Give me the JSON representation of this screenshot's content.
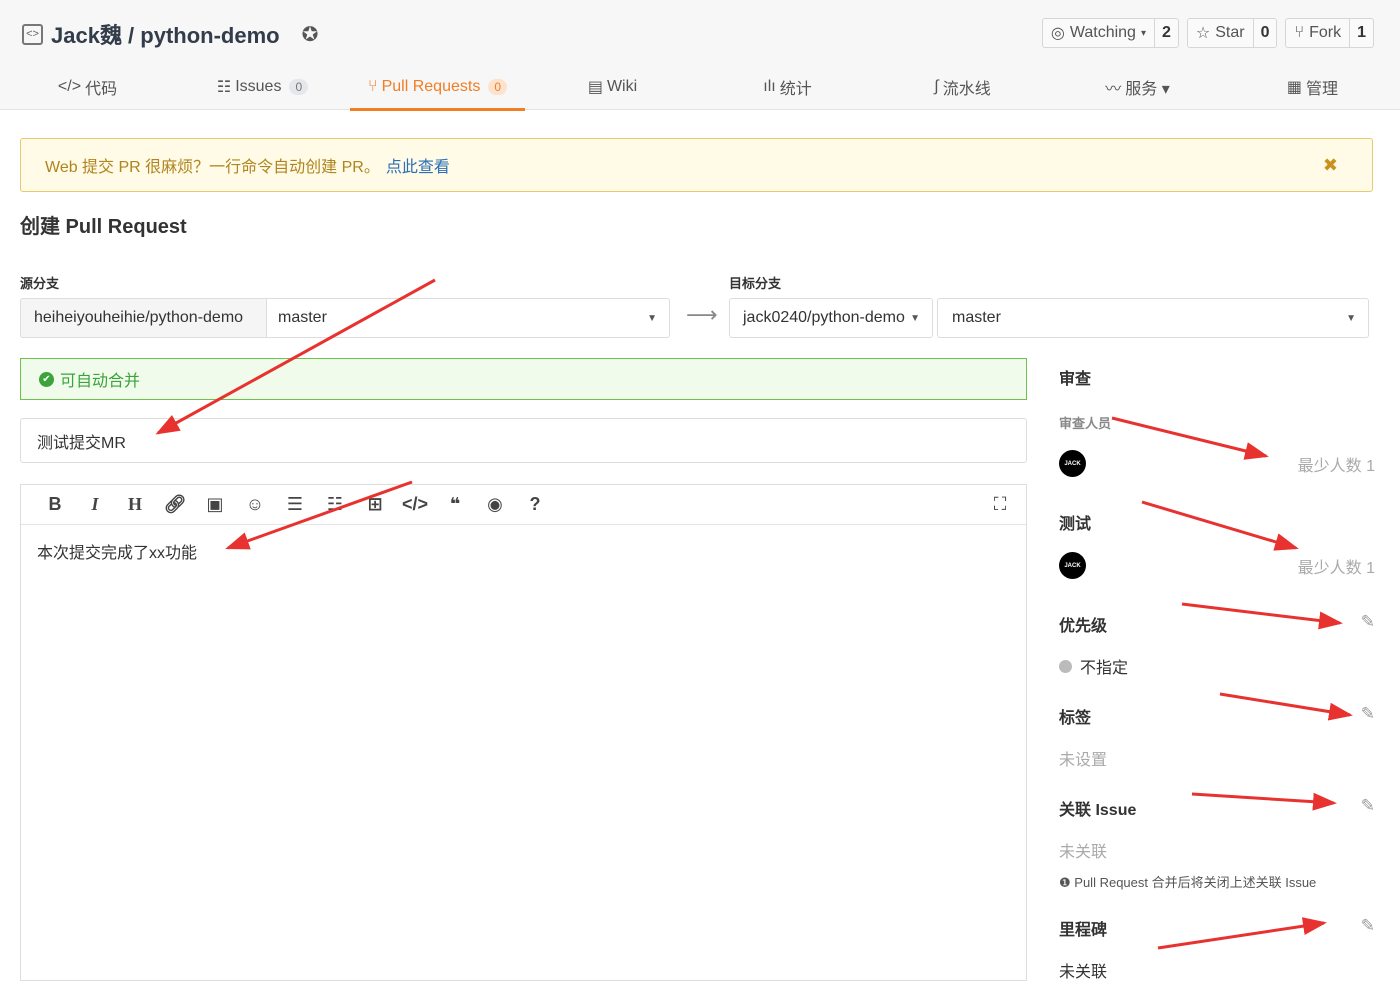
{
  "repo": {
    "title": "Jack魏 / python-demo",
    "icon": "code-box-icon",
    "badge_icon": "award-icon"
  },
  "actions": [
    {
      "label": "Watching",
      "count": "2",
      "icon": "eye-icon"
    },
    {
      "label": "Star",
      "count": "0",
      "icon": "star-icon"
    },
    {
      "label": "Fork",
      "count": "1",
      "icon": "fork-icon"
    }
  ],
  "tabs": [
    {
      "label": "代码",
      "icon": "</>"
    },
    {
      "label": "Issues",
      "count": "0",
      "icon": "☷"
    },
    {
      "label": "Pull Requests",
      "count": "0",
      "icon": "⑂",
      "active": true
    },
    {
      "label": "Wiki",
      "icon": "▤"
    },
    {
      "label": "统计",
      "icon": "ılı"
    },
    {
      "label": "流水线",
      "icon": "∫"
    },
    {
      "label": "服务 ▾",
      "icon": "〰"
    },
    {
      "label": "管理",
      "icon": "▦"
    }
  ],
  "banner": {
    "text": "Web 提交 PR 很麻烦？一行命令自动创建 PR。",
    "link": "点此查看",
    "close": "✖"
  },
  "page_title": "创建 Pull Request",
  "source": {
    "label": "源分支",
    "repo": "heiheiyouheihie/python-demo",
    "branch": "master"
  },
  "target": {
    "label": "目标分支",
    "repo": "jack0240/python-demo",
    "branch": "master"
  },
  "merge_status": "可自动合并",
  "pr_title": "测试提交MR",
  "description": "本次提交完成了xx功能",
  "sidebar": {
    "review": {
      "title": "审查",
      "sub": "审查人员",
      "avatar": "JACK",
      "min": "最少人数 1"
    },
    "test": {
      "title": "测试",
      "avatar": "JACK",
      "min": "最少人数 1"
    },
    "priority": {
      "title": "优先级",
      "value": "不指定"
    },
    "labels": {
      "title": "标签",
      "value": "未设置"
    },
    "issue": {
      "title": "关联 Issue",
      "value": "未关联",
      "note": "Pull Request 合并后将关闭上述关联 Issue"
    },
    "milestone": {
      "title": "里程碑",
      "value": "未关联"
    }
  },
  "colors": {
    "accent": "#f07e24",
    "success": "#3ca33a",
    "annotation": "#e8322f"
  }
}
